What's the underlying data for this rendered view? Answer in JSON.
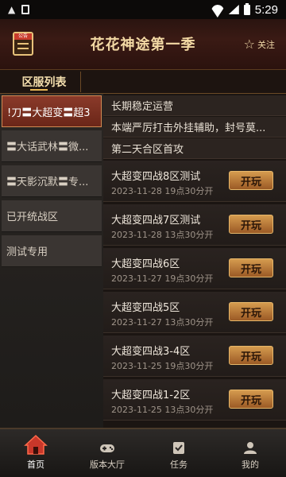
{
  "status_bar": {
    "left_icons": [
      "a-icon",
      "sim-card-icon"
    ],
    "time": "5:29"
  },
  "header": {
    "notice_label": "公告",
    "title": "花花神途第一季",
    "follow_label": "关注"
  },
  "subheader": {
    "tab_label": "区服列表"
  },
  "left_menu": {
    "items": [
      {
        "label": "!刀〓大超变〓超3",
        "active": true
      },
      {
        "label": "〓大话武林〓微...",
        "active": false
      },
      {
        "label": "〓天影沉默〓专...",
        "active": false
      },
      {
        "label": "已开统战区",
        "active": false
      },
      {
        "label": "测试专用",
        "active": false
      }
    ]
  },
  "notices": [
    "长期稳定运营",
    "本端严厉打击外挂辅助，封号莫...",
    "第二天合区首攻"
  ],
  "servers": [
    {
      "name": "大超变四战8区测试",
      "time": "2023-11-28 19点30分开",
      "button": "开玩"
    },
    {
      "name": "大超变四战7区测试",
      "time": "2023-11-28 13点30分开",
      "button": "开玩"
    },
    {
      "name": "大超变四战6区",
      "time": "2023-11-27 19点30分开",
      "button": "开玩"
    },
    {
      "name": "大超变四战5区",
      "time": "2023-11-27 13点30分开",
      "button": "开玩"
    },
    {
      "name": "大超变四战3-4区",
      "time": "2023-11-25 19点30分开",
      "button": "开玩"
    },
    {
      "name": "大超变四战1-2区",
      "time": "2023-11-25 13点30分开",
      "button": "开玩"
    }
  ],
  "bottom_nav": {
    "items": [
      {
        "label": "首页",
        "icon": "home-icon",
        "active": true
      },
      {
        "label": "版本大厅",
        "icon": "gamepad-icon",
        "active": false
      },
      {
        "label": "任务",
        "icon": "task-icon",
        "active": false
      },
      {
        "label": "我的",
        "icon": "user-icon",
        "active": false
      }
    ]
  },
  "colors": {
    "accent_gold": "#e8c27a",
    "play_button": "#c9893f",
    "active_tab_red": "#8a3a2a"
  }
}
